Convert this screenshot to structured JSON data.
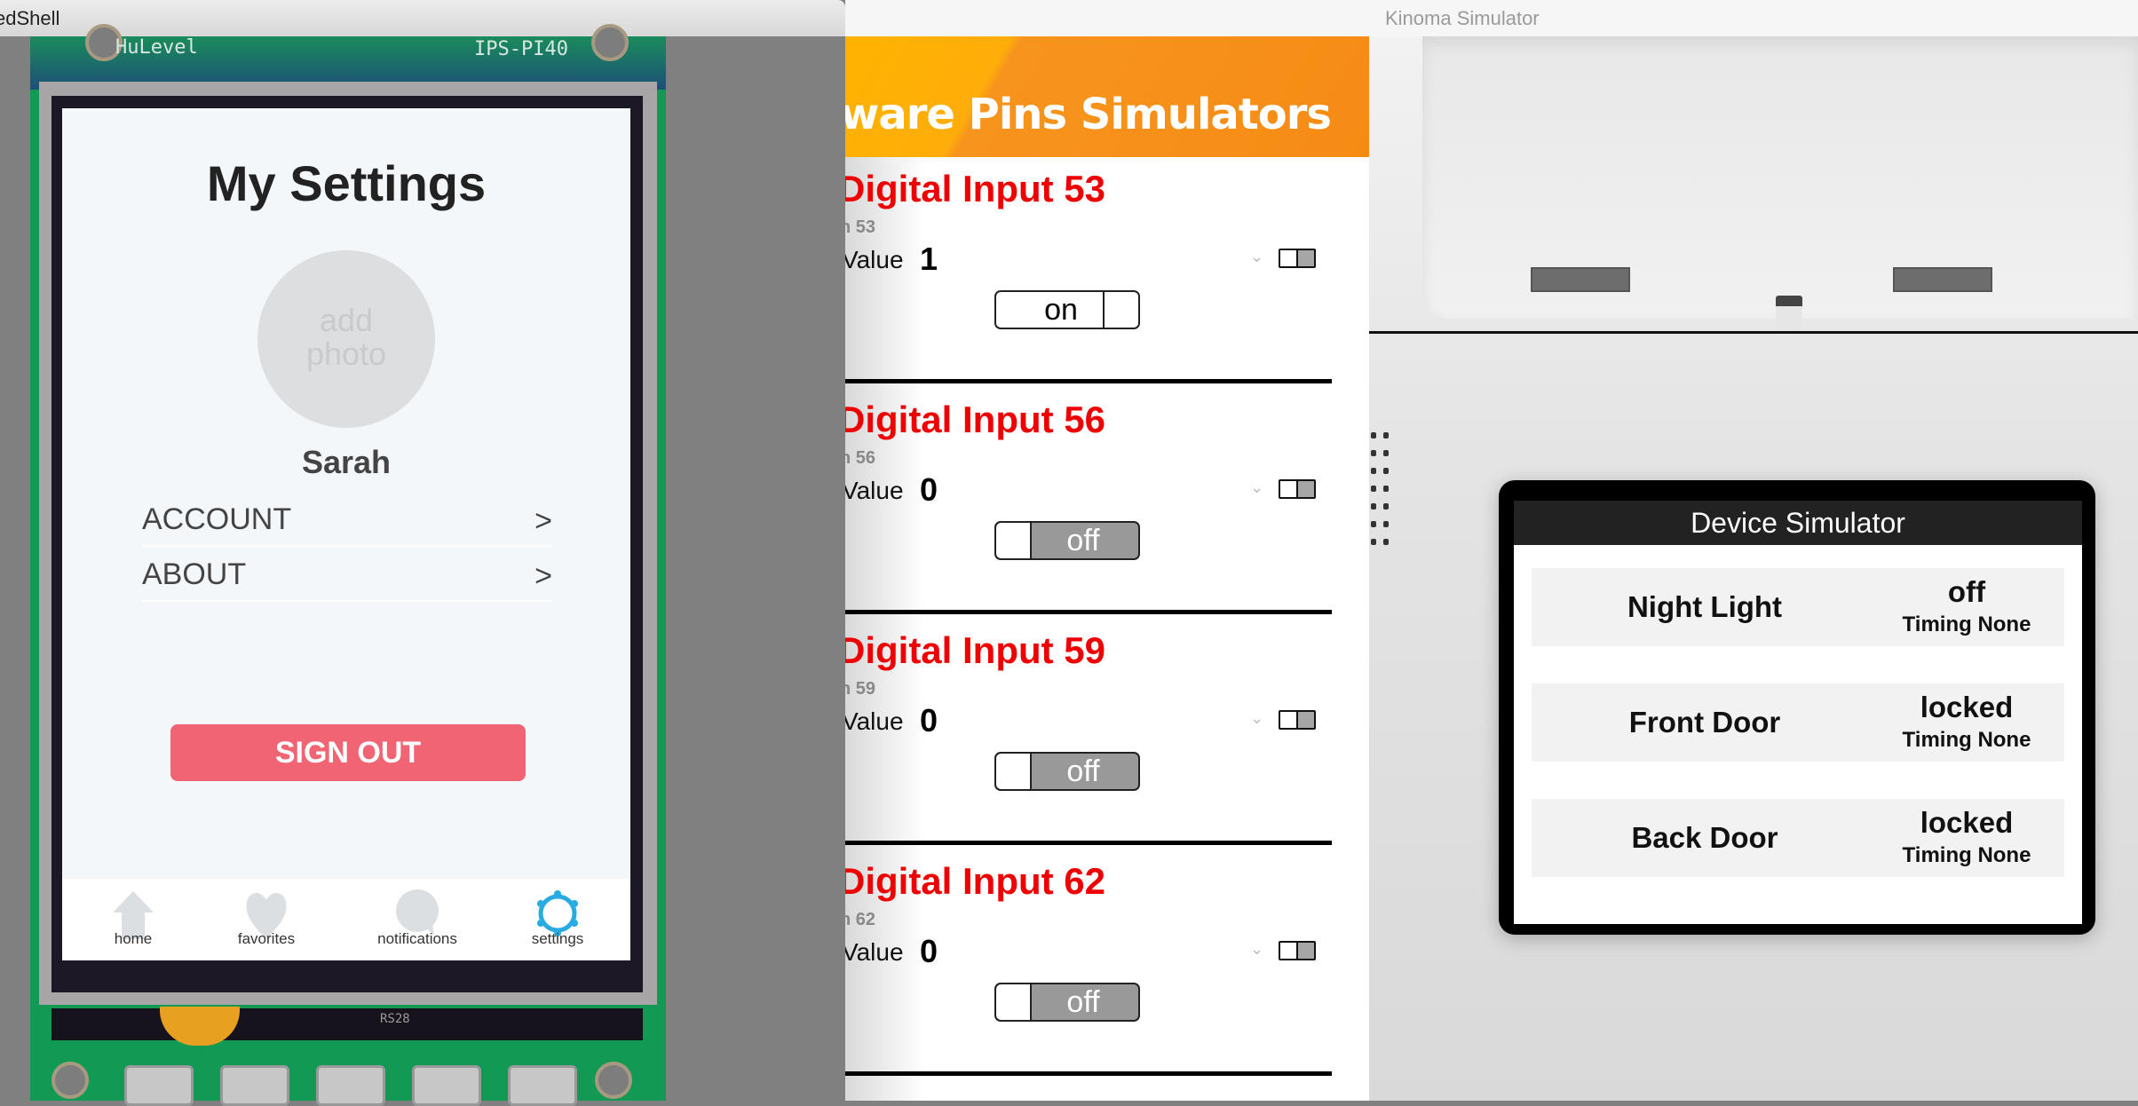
{
  "windows": {
    "left_title": "edShell",
    "right_title": "Kinoma Simulator"
  },
  "hardware": {
    "pcb_label_left": "HuLevel",
    "pcb_label_right": "IPS-PI40",
    "pcb_label_bottom": "RS28"
  },
  "app": {
    "title": "My Settings",
    "avatar_placeholder_line1": "add",
    "avatar_placeholder_line2": "photo",
    "user_name": "Sarah",
    "menu": [
      {
        "label": "ACCOUNT",
        "chevron": ">"
      },
      {
        "label": "ABOUT",
        "chevron": ">"
      }
    ],
    "sign_out_label": "SIGN OUT",
    "sign_out_color": "#f06473",
    "tabs": [
      {
        "label": "home",
        "icon": "home-icon",
        "active": false
      },
      {
        "label": "favorites",
        "icon": "heart-icon",
        "active": false
      },
      {
        "label": "notifications",
        "icon": "chat-bubble-icon",
        "active": false
      },
      {
        "label": "settings",
        "icon": "gear-icon",
        "active": true
      }
    ],
    "active_tab_color": "#29abe2",
    "inactive_tab_color": "#dcdfe2"
  },
  "pins_simulator": {
    "header_title": "ware Pins Simulators",
    "header_color": "#f7941d",
    "items": [
      {
        "title": "Digital Input 53",
        "subtitle": "n 53",
        "value_label": "Value",
        "value": "1",
        "switch_label": "on",
        "switch_state": "on"
      },
      {
        "title": "Digital Input 56",
        "subtitle": "n 56",
        "value_label": "Value",
        "value": "0",
        "switch_label": "off",
        "switch_state": "off"
      },
      {
        "title": "Digital Input 59",
        "subtitle": "n 59",
        "value_label": "Value",
        "value": "0",
        "switch_label": "off",
        "switch_state": "off"
      },
      {
        "title": "Digital Input 62",
        "subtitle": "n 62",
        "value_label": "Value",
        "value": "0",
        "switch_label": "off",
        "switch_state": "off"
      }
    ],
    "title_color": "#ef0000"
  },
  "device_simulator": {
    "title": "Device Simulator",
    "devices": [
      {
        "name": "Night Light",
        "state": "off",
        "timing": "Timing None"
      },
      {
        "name": "Front Door",
        "state": "locked",
        "timing": "Timing None"
      },
      {
        "name": "Back Door",
        "state": "locked",
        "timing": "Timing None"
      }
    ]
  }
}
